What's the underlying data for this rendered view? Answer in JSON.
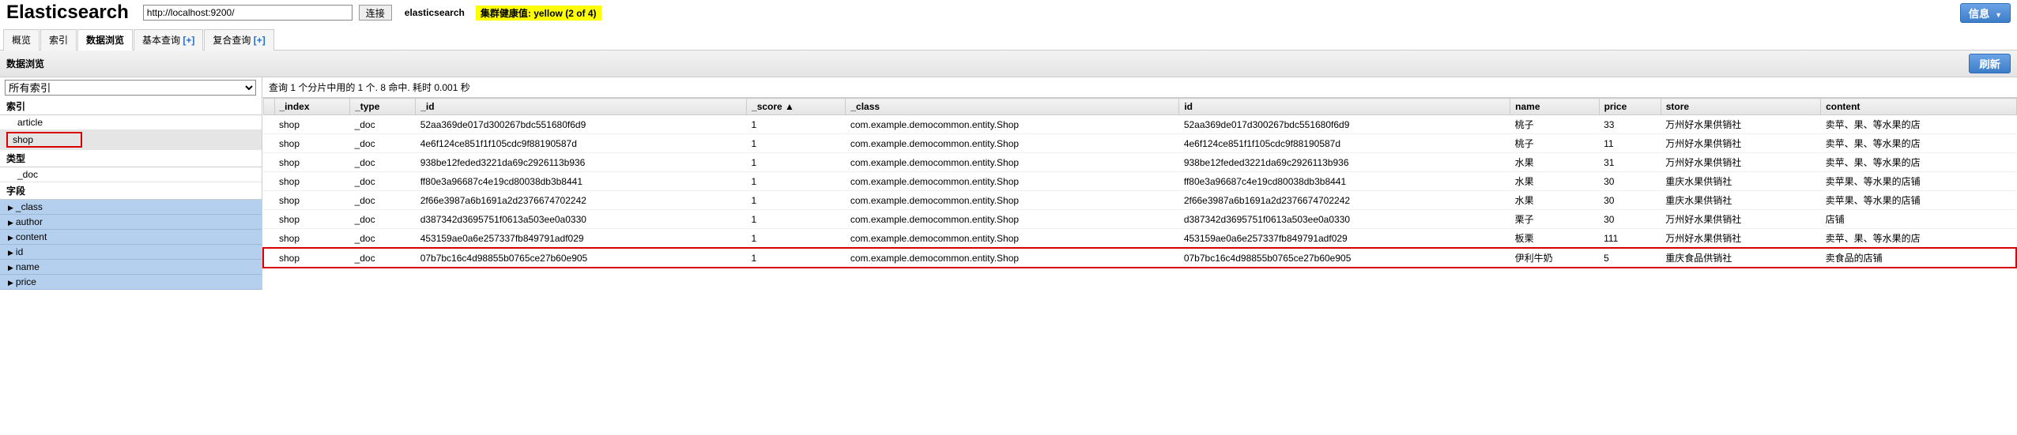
{
  "header": {
    "logo": "Elasticsearch",
    "url": "http://localhost:9200/",
    "connect": "连接",
    "cluster_name": "elasticsearch",
    "health_label": "集群健康值: yellow (2 of 4)",
    "info_btn": "信息"
  },
  "tabs": [
    {
      "label": "概览",
      "active": false,
      "plus": false
    },
    {
      "label": "索引",
      "active": false,
      "plus": false
    },
    {
      "label": "数据浏览",
      "active": true,
      "plus": false
    },
    {
      "label": "基本查询",
      "active": false,
      "plus": true
    },
    {
      "label": "复合查询",
      "active": false,
      "plus": true
    }
  ],
  "subheader": {
    "title": "数据浏览",
    "refresh": "刷新"
  },
  "sidebar": {
    "select_placeholder": "所有索引",
    "index_title": "索引",
    "indices": [
      {
        "name": "article",
        "selected": false,
        "boxed": false
      },
      {
        "name": "shop",
        "selected": true,
        "boxed": true
      }
    ],
    "type_title": "类型",
    "types": [
      {
        "name": "_doc"
      }
    ],
    "field_title": "字段",
    "fields": [
      {
        "name": "_class"
      },
      {
        "name": "author"
      },
      {
        "name": "content"
      },
      {
        "name": "id"
      },
      {
        "name": "name"
      },
      {
        "name": "price"
      }
    ]
  },
  "query_summary": "查询 1 个分片中用的 1 个. 8 命中. 耗时 0.001 秒",
  "columns": [
    "_index",
    "_type",
    "_id",
    "_score ▲",
    "_class",
    "id",
    "name",
    "price",
    "store",
    "content"
  ],
  "rows": [
    {
      "_index": "shop",
      "_type": "_doc",
      "_id": "52aa369de017d300267bdc551680f6d9",
      "_score": "1",
      "_class": "com.example.democommon.entity.Shop",
      "id": "52aa369de017d300267bdc551680f6d9",
      "name": "桃子",
      "price": "33",
      "store": "万州好水果供销社",
      "content": "卖苹、果、等水果的店",
      "hl": false
    },
    {
      "_index": "shop",
      "_type": "_doc",
      "_id": "4e6f124ce851f1f105cdc9f88190587d",
      "_score": "1",
      "_class": "com.example.democommon.entity.Shop",
      "id": "4e6f124ce851f1f105cdc9f88190587d",
      "name": "桃子",
      "price": "11",
      "store": "万州好水果供销社",
      "content": "卖苹、果、等水果的店",
      "hl": false
    },
    {
      "_index": "shop",
      "_type": "_doc",
      "_id": "938be12feded3221da69c2926113b936",
      "_score": "1",
      "_class": "com.example.democommon.entity.Shop",
      "id": "938be12feded3221da69c2926113b936",
      "name": "水果",
      "price": "31",
      "store": "万州好水果供销社",
      "content": "卖苹、果、等水果的店",
      "hl": false
    },
    {
      "_index": "shop",
      "_type": "_doc",
      "_id": "ff80e3a96687c4e19cd80038db3b8441",
      "_score": "1",
      "_class": "com.example.democommon.entity.Shop",
      "id": "ff80e3a96687c4e19cd80038db3b8441",
      "name": "水果",
      "price": "30",
      "store": "重庆水果供销社",
      "content": "卖苹果、等水果的店铺",
      "hl": false
    },
    {
      "_index": "shop",
      "_type": "_doc",
      "_id": "2f66e3987a6b1691a2d2376674702242",
      "_score": "1",
      "_class": "com.example.democommon.entity.Shop",
      "id": "2f66e3987a6b1691a2d2376674702242",
      "name": "水果",
      "price": "30",
      "store": "重庆水果供销社",
      "content": "卖苹果、等水果的店铺",
      "hl": false
    },
    {
      "_index": "shop",
      "_type": "_doc",
      "_id": "d387342d3695751f0613a503ee0a0330",
      "_score": "1",
      "_class": "com.example.democommon.entity.Shop",
      "id": "d387342d3695751f0613a503ee0a0330",
      "name": "栗子",
      "price": "30",
      "store": "万州好水果供销社",
      "content": "店铺",
      "hl": false
    },
    {
      "_index": "shop",
      "_type": "_doc",
      "_id": "453159ae0a6e257337fb849791adf029",
      "_score": "1",
      "_class": "com.example.democommon.entity.Shop",
      "id": "453159ae0a6e257337fb849791adf029",
      "name": "板栗",
      "price": "111",
      "store": "万州好水果供销社",
      "content": "卖苹、果、等水果的店",
      "hl": false
    },
    {
      "_index": "shop",
      "_type": "_doc",
      "_id": "07b7bc16c4d98855b0765ce27b60e905",
      "_score": "1",
      "_class": "com.example.democommon.entity.Shop",
      "id": "07b7bc16c4d98855b0765ce27b60e905",
      "name": "伊利牛奶",
      "price": "5",
      "store": "重庆食品供销社",
      "content": "卖食品的店铺",
      "hl": true
    }
  ]
}
